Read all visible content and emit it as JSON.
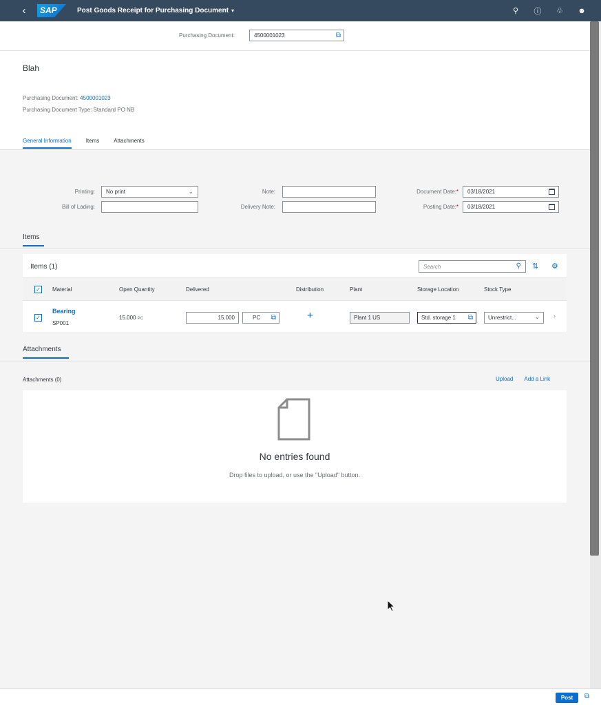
{
  "shell": {
    "logo": "SAP",
    "title": "Post Goods Receipt for Purchasing Document",
    "icons": [
      "search-icon",
      "help-icon",
      "notification-icon",
      "user-icon"
    ]
  },
  "header": {
    "purchasing_document_label": "Purchasing Document:",
    "purchasing_document_value": "4500001023"
  },
  "object": {
    "title": "Blah",
    "doc_label": "Purchasing Document:",
    "doc_value": "4500001023",
    "type_label": "Purchasing Document Type:",
    "type_value": "Standard PO NB",
    "tabs": [
      "General Information",
      "Items",
      "Attachments"
    ]
  },
  "form": {
    "printing_label": "Printing:",
    "printing_value": "No print",
    "bol_label": "Bill of Lading:",
    "bol_value": "",
    "note_label": "Note:",
    "note_value": "",
    "delivery_note_label": "Delivery Note:",
    "delivery_note_value": "",
    "document_date_label": "Document Date:",
    "document_date_value": "03/18/2021",
    "posting_date_label": "Posting Date:",
    "posting_date_value": "03/18/2021",
    "required_mark": "*"
  },
  "items_section": {
    "title": "Items",
    "table_title": "Items (1)",
    "search_placeholder": "Search",
    "columns": [
      "Material",
      "Open Quantity",
      "Delivered",
      "Distribution",
      "Plant",
      "Storage Location",
      "Stock Type"
    ],
    "rows": [
      {
        "material_name": "Bearing",
        "material_id": "SP001",
        "open_quantity": "15.000",
        "open_unit": "PC",
        "delivered": "15.000",
        "delivered_unit": "PC",
        "plant": "Plant 1 US",
        "storage_location": "Std. storage 1",
        "stock_type": "Unrestrict..."
      }
    ]
  },
  "attachments_section": {
    "title": "Attachments",
    "count_label": "Attachments (0)",
    "upload_label": "Upload",
    "add_link_label": "Add a Link",
    "empty_title": "No entries found",
    "empty_hint": "Drop files to upload, or use the \"Upload\" button."
  },
  "footer": {
    "post_label": "Post"
  },
  "colors": {
    "shell": "#354a5f",
    "accent": "#0a6ed1",
    "required": "#bb0000"
  }
}
